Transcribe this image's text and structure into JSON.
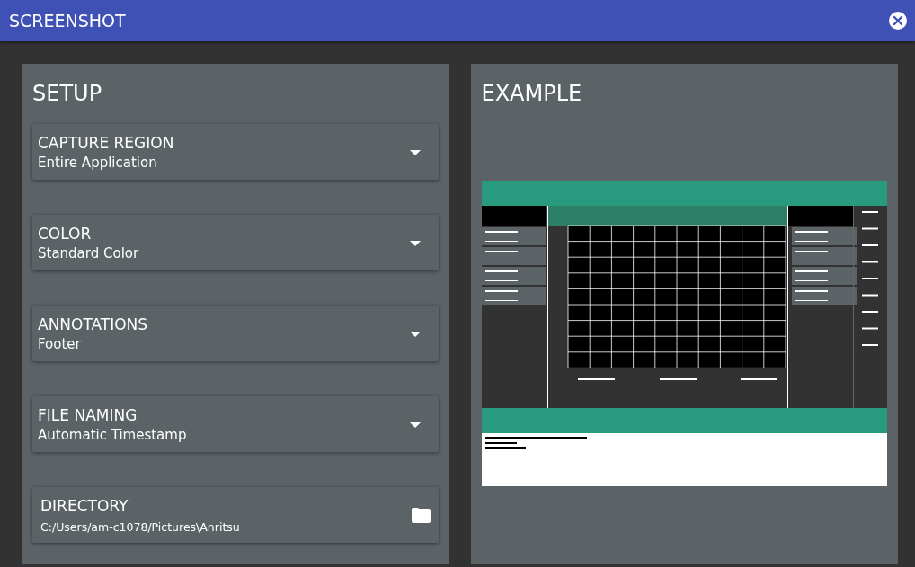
{
  "window": {
    "title": "SCREENSHOT"
  },
  "setup": {
    "heading": "SETUP",
    "fields": [
      {
        "kind": "dropdown",
        "label": "CAPTURE REGION",
        "value": "Entire Application"
      },
      {
        "kind": "dropdown",
        "label": "COLOR",
        "value": "Standard Color"
      },
      {
        "kind": "dropdown",
        "label": "ANNOTATIONS",
        "value": "Footer"
      },
      {
        "kind": "dropdown",
        "label": "FILE NAMING",
        "value": "Automatic Timestamp"
      },
      {
        "kind": "folder",
        "label": "DIRECTORY",
        "value": "C:/Users/am-c1078/Pictures\\Anritsu"
      }
    ]
  },
  "example": {
    "heading": "EXAMPLE"
  }
}
